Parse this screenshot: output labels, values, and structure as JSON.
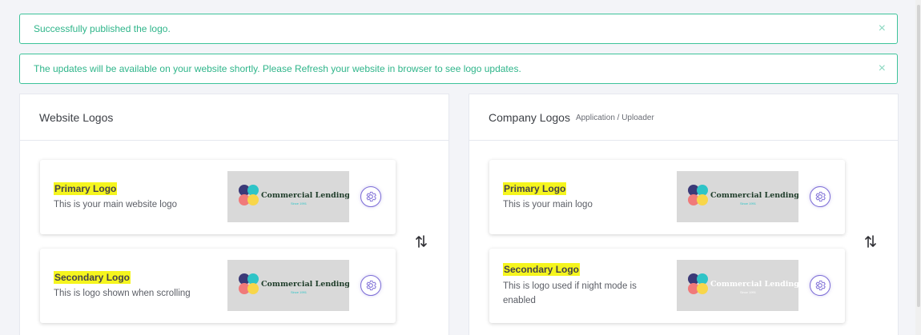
{
  "alerts": [
    {
      "message": "Successfully published the logo.",
      "close": "×"
    },
    {
      "message": "The updates will be available on your website shortly. Please Refresh your website in browser to see logo updates.",
      "close": "×"
    }
  ],
  "website_panel": {
    "title": "Website Logos",
    "primary": {
      "title": "Primary Logo",
      "desc": "This is your main website logo",
      "logo_name": "Commercial Lending",
      "logo_tagline": "Since 1991",
      "logo_text_color": "#1f3d2a"
    },
    "secondary": {
      "title": "Secondary Logo",
      "desc": "This is logo shown when scrolling",
      "logo_name": "Commercial Lending",
      "logo_tagline": "Since 1991",
      "logo_text_color": "#1f3d2a"
    }
  },
  "company_panel": {
    "title": "Company Logos",
    "subtitle": "Application / Uploader",
    "primary": {
      "title": "Primary Logo",
      "desc": "This is your main logo",
      "logo_name": "Commercial Lending",
      "logo_tagline": "Since 1991",
      "logo_text_color": "#1f3d2a"
    },
    "secondary": {
      "title": "Secondary Logo",
      "desc_line1": "This is logo used if night mode is",
      "desc_line2": "enabled",
      "logo_name": "Commercial Lending",
      "logo_tagline": "Since 1991",
      "logo_text_color": "#ffffff"
    }
  },
  "colors": {
    "alert_border": "#3dc39a",
    "alert_text": "#2fb58a",
    "highlight": "#f5f51e",
    "gear_accent": "#7c6cd6",
    "logo_circle_navy": "#3b3a78",
    "logo_circle_teal": "#2ec4c7",
    "logo_circle_pink": "#f07a7a",
    "logo_circle_yellow": "#f8d64a"
  },
  "icons": {
    "close": "close-icon",
    "settings": "gear-icon",
    "reorder": "swap-vertical-icon"
  }
}
